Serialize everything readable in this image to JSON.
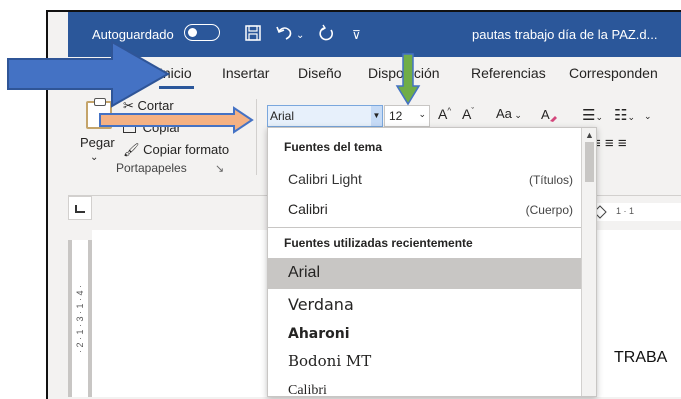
{
  "titlebar": {
    "autosave_label": "Autoguardado",
    "doc_title": "pautas trabajo día de la PAZ.d..."
  },
  "tabs": [
    "Inicio",
    "Insertar",
    "Diseño",
    "Disposición",
    "Referencias",
    "Corresponden"
  ],
  "clipboard": {
    "paste_label": "Pegar",
    "cut_label": "Cortar",
    "copy_label": "Copiar",
    "format_painter_label": "Copiar formato",
    "group_label": "Portapapeles"
  },
  "font": {
    "current_font": "Arial",
    "current_size": "12",
    "change_case_label": "Aa"
  },
  "dropdown": {
    "theme_header": "Fuentes del tema",
    "theme_fonts": [
      {
        "name": "Calibri Light",
        "tag": "(Títulos)"
      },
      {
        "name": "Calibri",
        "tag": "(Cuerpo)"
      }
    ],
    "recent_header": "Fuentes utilizadas recientemente",
    "recent_fonts": [
      "Arial",
      "Verdana",
      "Aharoni",
      "Bodoni MT",
      "Calibri"
    ],
    "selected_font": "Arial"
  },
  "ruler": {
    "vertical_marks": "· 2 · 1 · 3 · 1 · 4 ·",
    "horizontal_marks": "1 · 1"
  },
  "document": {
    "visible_text": "TRABA"
  },
  "colors": {
    "titlebar": "#2b579a",
    "arrow_fill": "#4472c4",
    "arrow_orange_fill": "#f4b183",
    "arrow_green_fill": "#70ad47",
    "selected_item": "#c8c6c4"
  },
  "icons": {
    "save": "save-icon",
    "undo": "undo-icon",
    "redo": "redo-icon",
    "customize": "customize-qat-icon",
    "bullets": "bullets-icon",
    "numbering": "numbering-icon",
    "align": "align-icon",
    "clear_format": "clear-formatting-icon"
  }
}
